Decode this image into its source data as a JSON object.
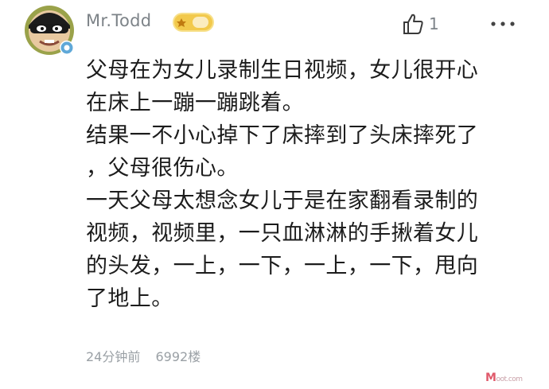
{
  "comment": {
    "user": {
      "name": "Mr.Todd",
      "level_badge_icon": "crown-level-icon",
      "verified_icon": "verified-check-icon",
      "avatar_icon": "masked-face-avatar"
    },
    "likes": {
      "icon": "thumbs-up-icon",
      "count": "1"
    },
    "more_icon": "more-dots-icon",
    "lines": [
      "父母在为女儿录制生日视频，女儿很开心",
      "在床上一蹦一蹦跳着。",
      "结果一不小心掉下了床摔到了头床摔死了",
      "，父母很伤心。",
      "一天父母太想念女儿于是在家翻看录制的",
      "视频，视频里，一只血淋淋的手揪着女儿",
      "的头发，一上，一下，一上，一下，甩向",
      "了地上。"
    ],
    "meta": {
      "time": "24分钟前",
      "floor": "6992楼"
    }
  },
  "watermark": {
    "text": "M",
    "small": "oot.com"
  },
  "colors": {
    "text": "#1c1c1c",
    "muted": "#7d8388",
    "badge_gold": "#f2c94c",
    "verified_blue": "#5fa8d8"
  }
}
